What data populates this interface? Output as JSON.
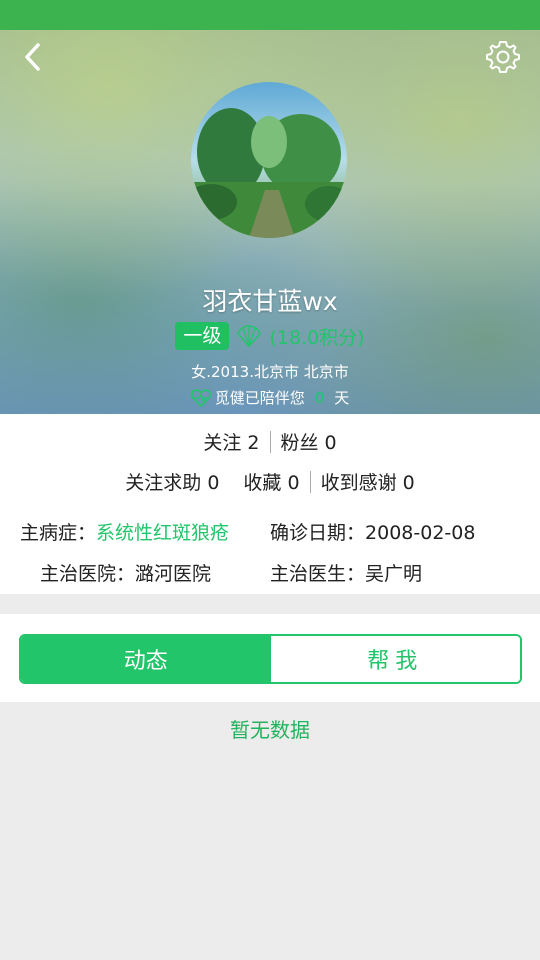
{
  "profile": {
    "username": "羽衣甘蓝wx",
    "level": "一级",
    "points": "(18.0积分)",
    "info": "女.2013.北京市 北京市",
    "companion_prefix": "觅健已陪伴您",
    "companion_days": "0",
    "companion_suffix": "天"
  },
  "stats": {
    "follow": "关注 2",
    "fans": "粉丝 0",
    "follow_help": "关注求助 0",
    "favorites": "收藏 0",
    "thanks": "收到感谢 0"
  },
  "medical": {
    "disease_label": "主病症：",
    "disease_value": "系统性红斑狼疮",
    "diagnosis_label": "确诊日期：",
    "diagnosis_value": "2008-02-08",
    "hospital_label": "主治医院：",
    "hospital_value": "潞河医院",
    "doctor_label": "主治医生：",
    "doctor_value": "吴广明"
  },
  "tabs": [
    {
      "label": "动态"
    },
    {
      "label": "帮我"
    }
  ],
  "empty_text": "暂无数据",
  "colors": {
    "accent": "#22c56a",
    "statusbar": "#3db34f"
  },
  "icons": [
    "back-arrow-icon",
    "gear-icon",
    "shell-icon",
    "heart-icon"
  ]
}
